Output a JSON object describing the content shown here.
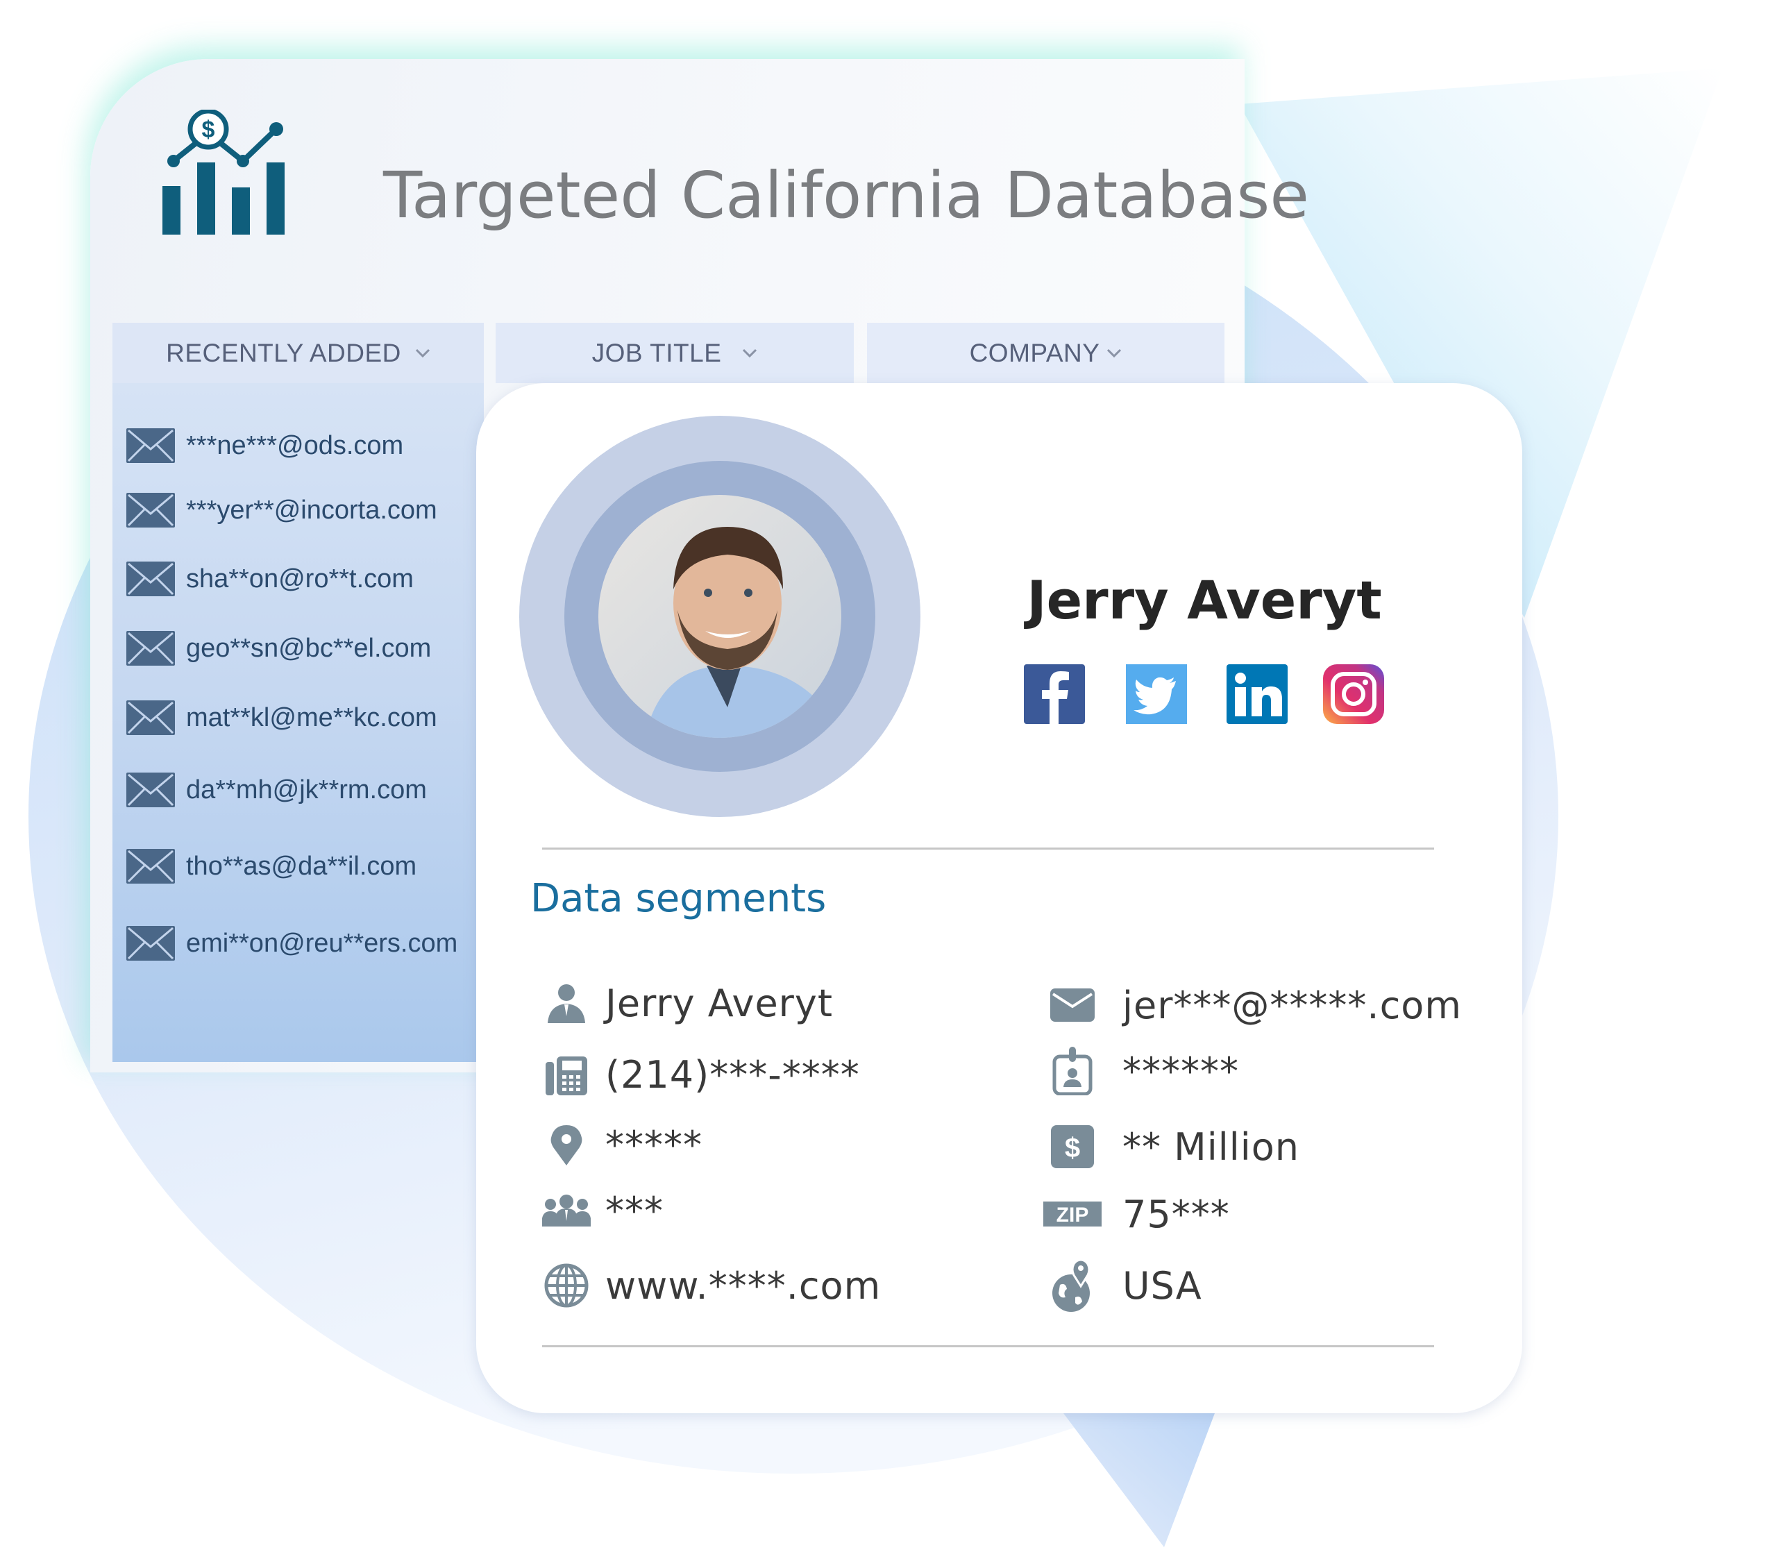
{
  "header": {
    "title": "Targeted California Database",
    "logo_icon": "chart-dollar-icon"
  },
  "tabs": [
    {
      "label": "RECENTLY ADDED",
      "icon": "chevron-down-icon"
    },
    {
      "label": "JOB TITLE",
      "icon": "chevron-down-icon"
    },
    {
      "label": "COMPANY",
      "icon": "chevron-down-icon"
    }
  ],
  "email_list": [
    {
      "email": "***ne***@ods.com",
      "icon": "envelope-icon"
    },
    {
      "email": "***yer**@incorta.com",
      "icon": "envelope-icon"
    },
    {
      "email": "sha**on@ro**t.com",
      "icon": "envelope-icon"
    },
    {
      "email": "geo**sn@bc**el.com",
      "icon": "envelope-icon"
    },
    {
      "email": "mat**kl@me**kc.com",
      "icon": "envelope-icon"
    },
    {
      "email": "da**mh@jk**rm.com",
      "icon": "envelope-icon"
    },
    {
      "email": "tho**as@da**il.com",
      "icon": "envelope-icon"
    },
    {
      "email": "emi**on@reu**ers.com",
      "icon": "envelope-icon"
    }
  ],
  "profile": {
    "name": "Jerry Averyt",
    "avatar": "profile-photo",
    "social": [
      {
        "name": "facebook",
        "icon": "facebook-icon",
        "color": "#3b5998"
      },
      {
        "name": "twitter",
        "icon": "twitter-icon",
        "color": "#55acee"
      },
      {
        "name": "linkedin",
        "icon": "linkedin-icon",
        "color": "#0077b5"
      },
      {
        "name": "instagram",
        "icon": "instagram-icon",
        "color": "#c13584"
      }
    ]
  },
  "data_segments": {
    "title": "Data segments",
    "left": [
      {
        "icon": "person-icon",
        "value": "Jerry Averyt"
      },
      {
        "icon": "phone-icon",
        "value": "(214)***-****"
      },
      {
        "icon": "location-pin-icon",
        "value": "*****"
      },
      {
        "icon": "group-icon",
        "value": "***"
      },
      {
        "icon": "globe-icon",
        "value": "www.****.com"
      }
    ],
    "right": [
      {
        "icon": "envelope-icon",
        "value": "jer***@*****.com"
      },
      {
        "icon": "id-badge-icon",
        "value": "******"
      },
      {
        "icon": "dollar-icon",
        "value": "** Million"
      },
      {
        "icon": "zip-icon",
        "value": "75***",
        "icon_label": "ZIP"
      },
      {
        "icon": "globe-pin-icon",
        "value": "USA"
      }
    ]
  },
  "colors": {
    "accent": "#1a6e9e",
    "icon_gray": "#7a8c98",
    "logo": "#0f5e7c",
    "envelope": "#4a6788"
  }
}
